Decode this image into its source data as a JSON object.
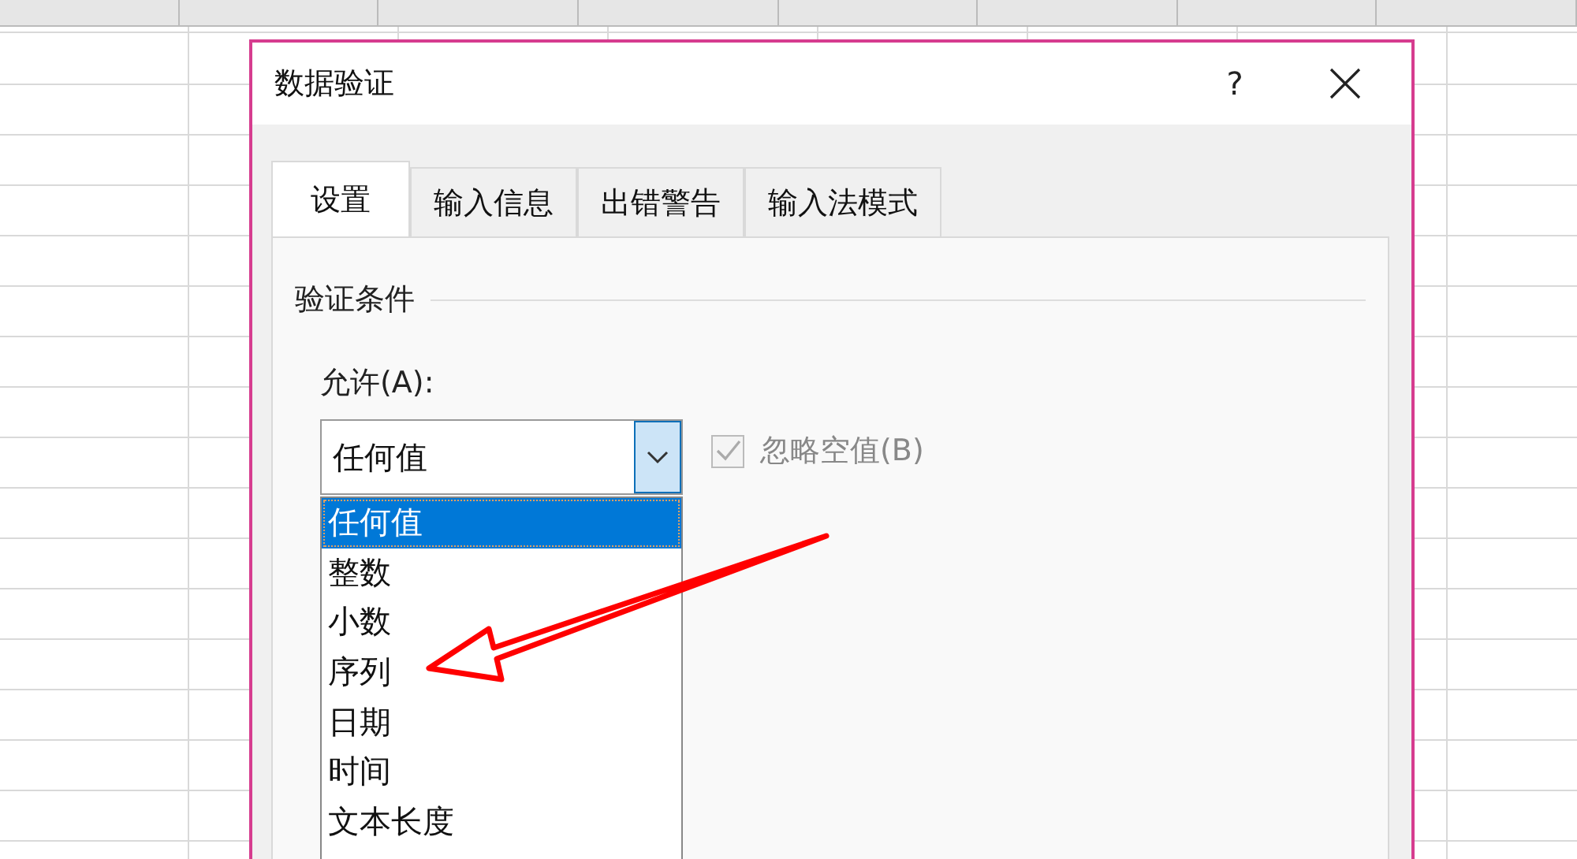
{
  "dialog": {
    "title": "数据验证",
    "help": "?",
    "tabs": [
      {
        "label": "设置",
        "selected": true
      },
      {
        "label": "输入信息",
        "selected": false
      },
      {
        "label": "出错警告",
        "selected": false
      },
      {
        "label": "输入法模式",
        "selected": false
      }
    ],
    "group_title": "验证条件",
    "allow_label": "允许(A):",
    "allow_value": "任何值",
    "ignore_blank": {
      "label": "忽略空值(B)",
      "checked": true,
      "disabled": true
    },
    "options": [
      {
        "label": "任何值",
        "selected": true
      },
      {
        "label": "整数",
        "selected": false
      },
      {
        "label": "小数",
        "selected": false
      },
      {
        "label": "序列",
        "selected": false
      },
      {
        "label": "日期",
        "selected": false
      },
      {
        "label": "时间",
        "selected": false
      },
      {
        "label": "文本长度",
        "selected": false
      }
    ]
  }
}
